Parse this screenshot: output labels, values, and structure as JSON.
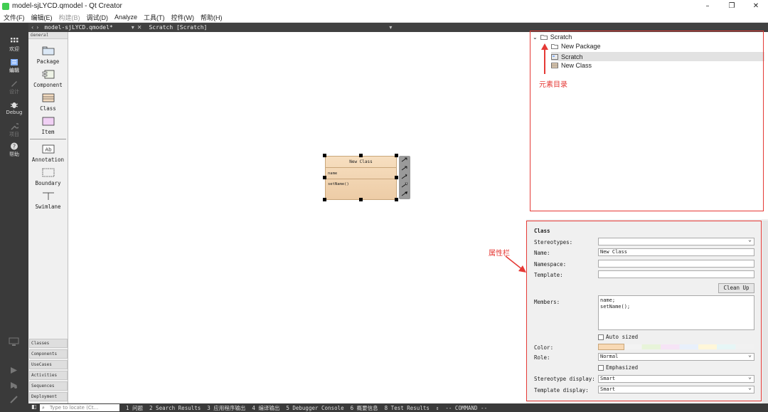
{
  "window": {
    "title": "model-sjLYCD.qmodel - Qt Creator",
    "buttons": [
      "–",
      "❐",
      "✕"
    ]
  },
  "menu": [
    {
      "label": "文件(F)",
      "enabled": true
    },
    {
      "label": "编辑(E)",
      "enabled": true
    },
    {
      "label": "构建(B)",
      "enabled": false
    },
    {
      "label": "调试(D)",
      "enabled": true
    },
    {
      "label": "Analyze",
      "enabled": true
    },
    {
      "label": "工具(T)",
      "enabled": true
    },
    {
      "label": "控件(W)",
      "enabled": true
    },
    {
      "label": "帮助(H)",
      "enabled": true
    }
  ],
  "modes": [
    {
      "label": "欢迎",
      "icon": "grid-icon"
    },
    {
      "label": "编辑",
      "icon": "edit-icon",
      "active": true
    },
    {
      "label": "设计",
      "icon": "pen-icon",
      "dim": true
    },
    {
      "label": "Debug",
      "icon": "bug-icon"
    },
    {
      "label": "项目",
      "icon": "wrench-icon",
      "dim": true
    },
    {
      "label": "帮助",
      "icon": "help-icon"
    }
  ],
  "doc_toolbar": {
    "file": "model-sjLYCD.qmodel*",
    "crumb": "Scratch [Scratch]"
  },
  "palette": {
    "header": "General",
    "tools": [
      "Package",
      "Component",
      "Class",
      "Item",
      "Annotation",
      "Boundary",
      "Swimlane"
    ],
    "categories": [
      "Classes",
      "Components",
      "UseCases",
      "Activities",
      "Sequences",
      "Deployment"
    ]
  },
  "diagram": {
    "class_name": "New Class",
    "attribute": "name",
    "method": "setName()"
  },
  "tree": {
    "root": "Scratch",
    "children": [
      "New Package",
      "Scratch",
      "New Class"
    ],
    "selected": "Scratch"
  },
  "annotations": {
    "tree_label": "元素目录",
    "props_label": "属性栏"
  },
  "properties": {
    "heading": "Class",
    "labels": {
      "stereotypes": "Stereotypes:",
      "name": "Name:",
      "namespace": "Namespace:",
      "template": "Template:",
      "members": "Members:",
      "color": "Color:",
      "role": "Role:",
      "stereotype_display": "Stereotype display:",
      "template_display": "Template display:"
    },
    "values": {
      "stereotypes": "",
      "name": "New Class",
      "namespace": "",
      "template": "",
      "members_line1": "name;",
      "members_line2": "setName();",
      "role": "Normal",
      "stereotype_display": "Smart",
      "template_display": "Smart"
    },
    "cleanup": "Clean Up",
    "auto_sized": "Auto sized",
    "emphasized": "Emphasized",
    "color_swatch": "#f8d9b4"
  },
  "status": {
    "locate_placeholder": "Type to locate (Ct...",
    "outputs": [
      "1 问题",
      "2 Search Results",
      "3 应用程序输出",
      "4 编译输出",
      "5 Debugger Console",
      "6 概要信息",
      "8 Test Results",
      "⇕",
      "-- COMMAND --"
    ]
  }
}
